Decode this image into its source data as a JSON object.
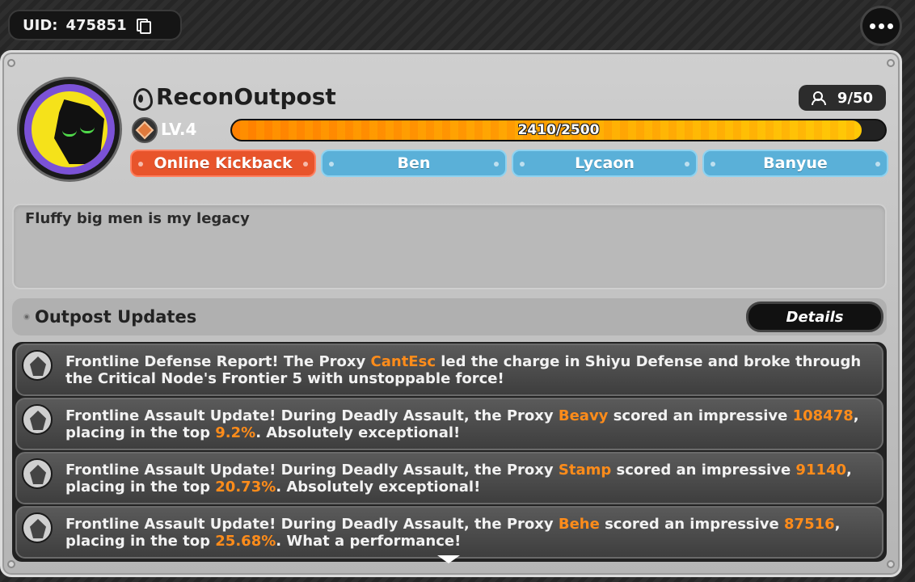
{
  "uid": {
    "label": "UID:",
    "value": "475851"
  },
  "profile": {
    "name": "ReconOutpost",
    "level_label": "LV.4",
    "xp_text": "2410/2500",
    "xp_fraction": 0.964,
    "members": "9/50"
  },
  "tags": [
    "Online Kickback",
    "Ben",
    "Lycaon",
    "Banyue"
  ],
  "bio": "Fluffy big men is my legacy",
  "updates": {
    "title": "Outpost Updates",
    "details_label": "Details",
    "items": [
      {
        "pre": "Frontline Defense Report! The Proxy ",
        "proxy": "CantEsc",
        "mid": " led the charge in Shiyu Defense and broke through the Critical Node's Frontier 5 with unstoppable force!",
        "score": "",
        "mid2": "",
        "percent": "",
        "post": ""
      },
      {
        "pre": "Frontline Assault Update! During Deadly Assault, the Proxy ",
        "proxy": "Beavy",
        "mid": " scored an impressive ",
        "score": "108478",
        "mid2": ", placing in the top ",
        "percent": "9.2%",
        "post": ". Absolutely exceptional!"
      },
      {
        "pre": "Frontline Assault Update! During Deadly Assault, the Proxy ",
        "proxy": "Stamp",
        "mid": " scored an impressive ",
        "score": "91140",
        "mid2": ", placing in the top ",
        "percent": "20.73%",
        "post": ". Absolutely exceptional!"
      },
      {
        "pre": "Frontline Assault Update! During Deadly Assault, the Proxy ",
        "proxy": "Behe",
        "mid": " scored an impressive ",
        "score": "87516",
        "mid2": ", placing in the top ",
        "percent": "25.68%",
        "post": ". What a performance!"
      }
    ]
  },
  "colors": {
    "highlight": "#ff8c1a",
    "primary_tag": "#e8542b",
    "secondary_tag": "#5ab0d8"
  }
}
